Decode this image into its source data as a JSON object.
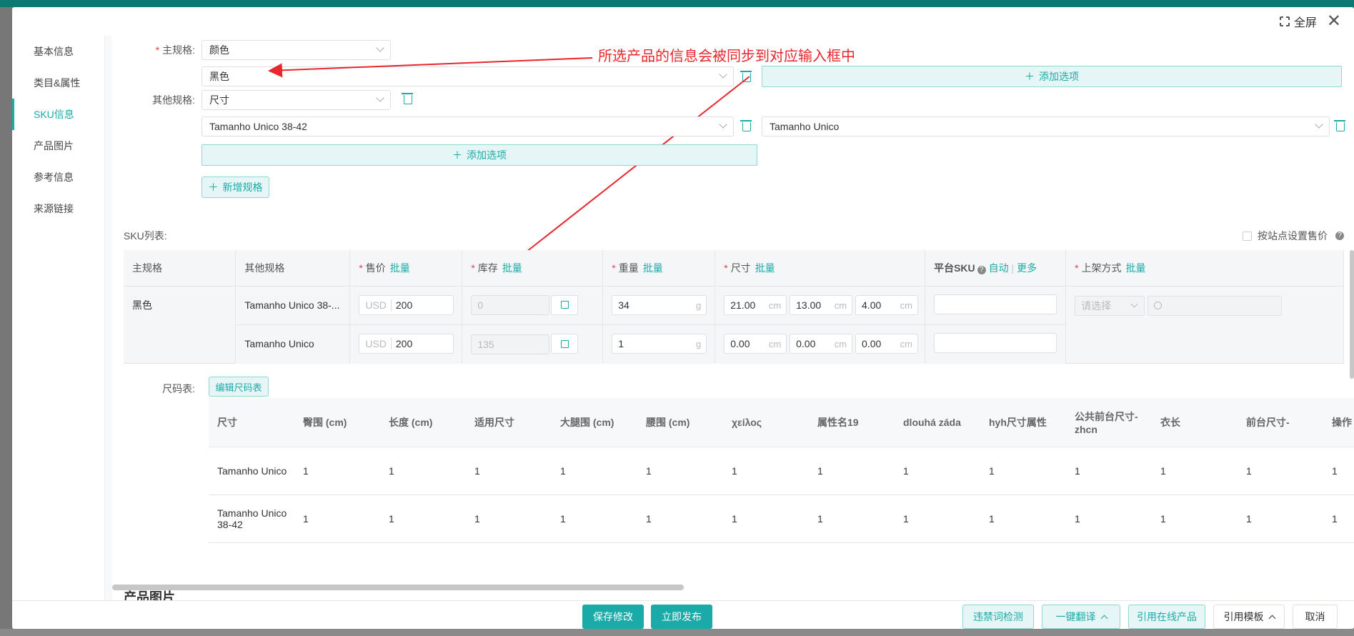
{
  "header": {
    "fullscreen_label": "全屏"
  },
  "sidebar": {
    "items": [
      {
        "label": "基本信息"
      },
      {
        "label": "类目&属性"
      },
      {
        "label": "SKU信息"
      },
      {
        "label": "产品图片"
      },
      {
        "label": "参考信息"
      },
      {
        "label": "来源链接"
      }
    ]
  },
  "spec": {
    "main_label": "主规格:",
    "main_value": "颜色",
    "main_option": "黑色",
    "add_option": "添加选项",
    "other_label": "其他规格:",
    "other_value": "尺寸",
    "other_option_1": "Tamanho Unico 38-42",
    "other_option_2": "Tamanho Unico",
    "add_spec": "新增规格",
    "annotation": "所选产品的信息会被同步到对应输入框中"
  },
  "sku": {
    "list_label": "SKU列表:",
    "site_price_label": "按站点设置售价",
    "headers": {
      "main": "主规格",
      "other": "其他规格",
      "price": "售价",
      "stock": "库存",
      "weight": "重量",
      "size": "尺寸",
      "platform_sku": "平台SKU",
      "auto": "自动",
      "more": "更多",
      "listing": "上架方式",
      "batch": "批量"
    },
    "currency": "USD",
    "cm": "cm",
    "g": "g",
    "select_placeholder": "请选择",
    "main_value": "黑色",
    "rows": [
      {
        "other": "Tamanho Unico 38-...",
        "price": "200",
        "stock": "0",
        "weight": "34",
        "l": "21.00",
        "w": "13.00",
        "h": "4.00"
      },
      {
        "other": "Tamanho Unico",
        "price": "200",
        "stock": "135",
        "weight": "1",
        "l": "0.00",
        "w": "0.00",
        "h": "0.00"
      }
    ]
  },
  "size_chart": {
    "label": "尺码表:",
    "edit_button": "编辑尺码表",
    "headers": [
      "尺寸",
      "臀围 (cm)",
      "长度 (cm)",
      "适用尺寸",
      "大腿围 (cm)",
      "腰围 (cm)",
      "χείλος",
      "属性名19",
      "dlouhá záda",
      "hyh尺寸属性",
      "公共前台尺寸-zhcn",
      "衣长",
      "前台尺寸-",
      "操作"
    ],
    "rows": [
      [
        "Tamanho Unico",
        "1",
        "1",
        "1",
        "1",
        "1",
        "1",
        "1",
        "1",
        "1",
        "1",
        "1",
        "1",
        "1"
      ],
      [
        "Tamanho Unico 38-42",
        "1",
        "1",
        "1",
        "1",
        "1",
        "1",
        "1",
        "1",
        "1",
        "1",
        "1",
        "1",
        "1"
      ]
    ]
  },
  "next_section_title": "产品图片",
  "footer": {
    "save": "保存修改",
    "publish": "立即发布",
    "banned_check": "违禁词检测",
    "translate": "一键翻译",
    "cite_online": "引用在线产品",
    "cite_template": "引用模板",
    "cancel": "取消"
  },
  "colors": {
    "accent": "#1aaba8",
    "annotation": "#e8262c"
  }
}
